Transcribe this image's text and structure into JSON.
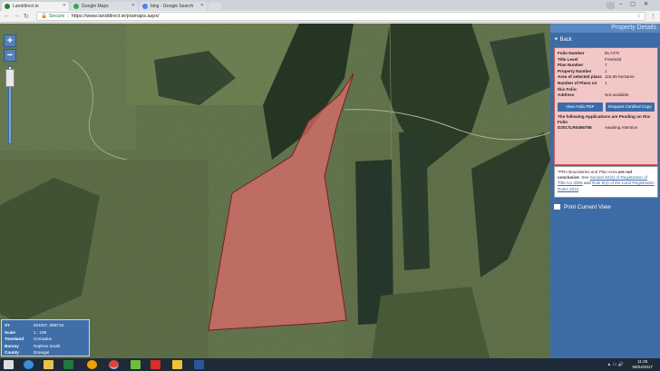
{
  "browser": {
    "tabs": [
      {
        "title": "Landdirect.ie",
        "color": "#2e7d32"
      },
      {
        "title": "Google Maps",
        "color": "#34a853"
      },
      {
        "title": "bing - Google Search",
        "color": "#4285f4"
      }
    ],
    "secure_label": "Secure",
    "url": "https://www.landdirect.ie/pramaps.aspx/"
  },
  "map": {
    "zoom_in": "+",
    "zoom_out": "−",
    "zoom_level_fraction": 0.25,
    "parcel_fill": "#e06b6b",
    "info": [
      {
        "key": "XY",
        "value": "601057, 898716"
      },
      {
        "key": "Scale",
        "value": "1 : 10K"
      },
      {
        "key": "Townland",
        "value": "Cronadun"
      },
      {
        "key": "Barony",
        "value": "Raphoe South"
      },
      {
        "key": "County",
        "value": "Donegal"
      }
    ]
  },
  "panel": {
    "title": "Property Details",
    "back_label": "Back",
    "details": [
      {
        "key": "Folio Number",
        "value": "DL7470"
      },
      {
        "key": "Title Level",
        "value": "Freehold"
      },
      {
        "key": "Plan Number",
        "value": "7"
      },
      {
        "key": "Property Number",
        "value": "1"
      },
      {
        "key": "Area of selected plans",
        "value": "115.69 hectares"
      },
      {
        "key": "Number of Plans on this Folio:",
        "value": "1"
      },
      {
        "key": "Address",
        "value": "Not available"
      }
    ],
    "view_pdf_label": "View Folio PDF",
    "request_copy_label": "Request Certified Copy",
    "pending_heading": "The following Applications are Pending on this Folio",
    "pending_key": "D2017LR045675E",
    "pending_value": "Awaiting Attention",
    "notice_part1": "*PRA Boundaries and Plan Area",
    "notice_bold": "are not conclusive",
    "notice_part2": ". See",
    "notice_link1": "Section 62(2) of Registration of Title Act 2006",
    "notice_and": "and",
    "notice_link2": "Rule 8(3) of the Land Registration Rules 2012",
    "print_label": "Print Current View"
  },
  "taskbar": {
    "icons": [
      "start-icon",
      "ie-icon",
      "file-explorer-icon",
      "store-icon",
      "excel-icon",
      "media-icon",
      "chrome-icon",
      "app-icon",
      "app2-icon",
      "notes-icon",
      "word-icon"
    ],
    "time": "11:36",
    "date": "06/04/2017"
  }
}
